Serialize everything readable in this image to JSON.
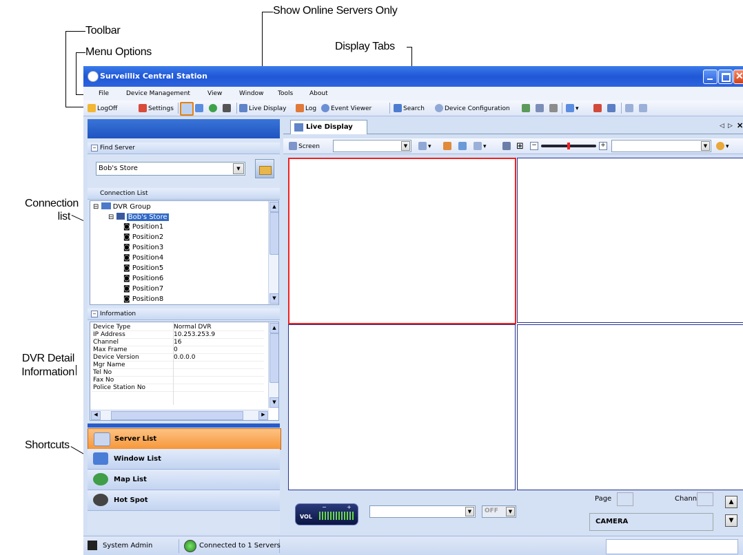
{
  "callouts": {
    "show_online": "Show Online Servers Only",
    "toolbar": "Toolbar",
    "menu_options": "Menu Options",
    "display_tabs": "Display Tabs",
    "connection_list": "Connection\nlist",
    "dvr_detail": "DVR Detail\nInformation",
    "shortcuts": "Shortcuts"
  },
  "window": {
    "title": "Surveillix Central Station"
  },
  "menu": [
    "File",
    "Device Management",
    "View",
    "Window",
    "Tools",
    "About"
  ],
  "toolbar": {
    "logoff": "LogOff",
    "settings": "Settings",
    "live_display": "Live Display",
    "log": "Log",
    "event_viewer": "Event Viewer",
    "search": "Search",
    "device_configuration": "Device Configuration"
  },
  "find_server": {
    "header": "Find Server",
    "selected": "Bob's Store"
  },
  "connection_list": {
    "header": "Connection List",
    "group": "DVR Group",
    "server": "Bob's Store",
    "positions": [
      "Position1",
      "Position2",
      "Position3",
      "Position4",
      "Position5",
      "Position6",
      "Position7",
      "Position8"
    ]
  },
  "information": {
    "header": "Information",
    "rows": [
      {
        "k": "Device Type",
        "v": "Normal DVR"
      },
      {
        "k": "IP Address",
        "v": "10.253.253.9"
      },
      {
        "k": "Channel",
        "v": "16"
      },
      {
        "k": "Max Frame",
        "v": "0"
      },
      {
        "k": "Device Version",
        "v": "0.0.0.0"
      },
      {
        "k": "Mgr Name",
        "v": ""
      },
      {
        "k": "Tel No",
        "v": ""
      },
      {
        "k": "Fax No",
        "v": ""
      },
      {
        "k": "Police Station No",
        "v": ""
      }
    ]
  },
  "shortcuts": [
    {
      "label": "Server List",
      "active": true
    },
    {
      "label": "Window List",
      "active": false
    },
    {
      "label": "Map List",
      "active": false
    },
    {
      "label": "Hot Spot",
      "active": false
    }
  ],
  "status": {
    "user": "System Admin",
    "connection": "Connected to 1 Servers"
  },
  "tabs": {
    "active": "Live Display"
  },
  "display_toolbar": {
    "screen": "Screen"
  },
  "bottom": {
    "vol": "VOL",
    "off": "OFF",
    "page": "Page",
    "channel": "Channel",
    "camera": "CAMERA"
  },
  "colors": {
    "titlebar": "#1f57d6",
    "selected_cell": "#ee2222",
    "cell_border": "#22338f",
    "active_shortcut": "#f6973a"
  }
}
